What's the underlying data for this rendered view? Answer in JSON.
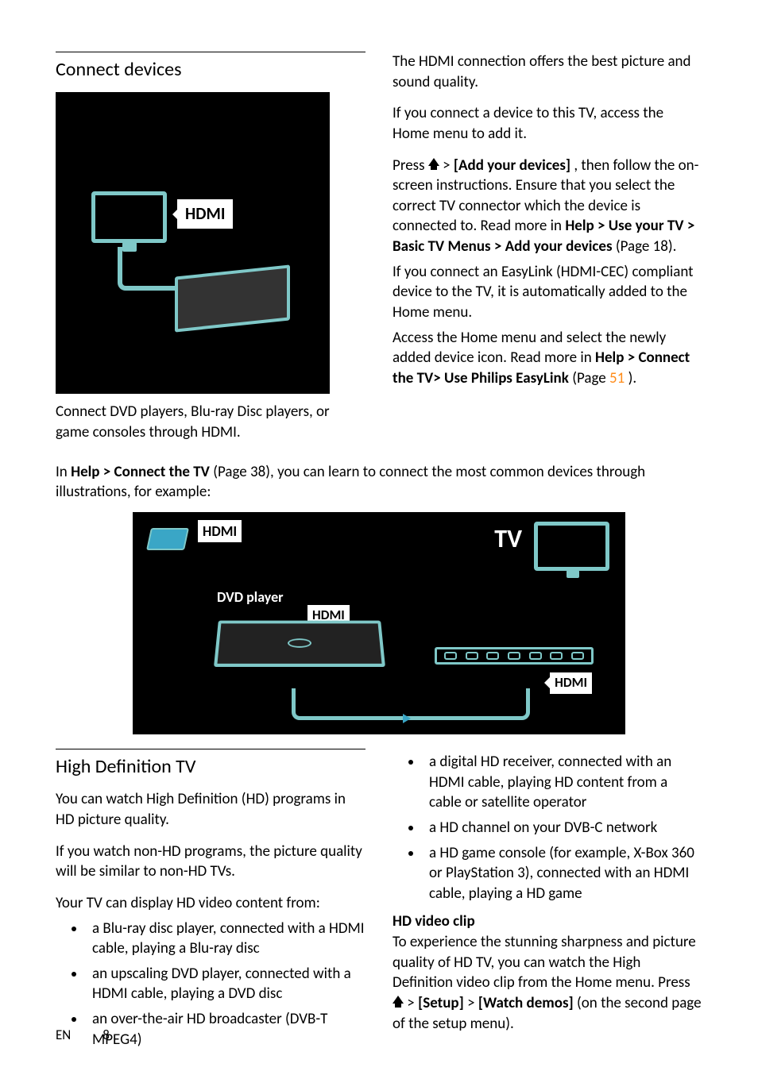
{
  "section1": {
    "heading": "Connect devices",
    "hdmiLabel": "HDMI",
    "caption": "Connect DVD players, Blu-ray Disc players, or game consoles through HDMI."
  },
  "rightCol": {
    "p1": "The HDMI connection offers the best picture and sound quality.",
    "p2": "If you connect a device to this TV, access the Home menu to add it.",
    "p3a": "Press ",
    "p3b": " > ",
    "p3bold1": "[Add your devices]",
    "p3c": ", then follow the on-screen instructions. Ensure that you select the correct TV connector which the device is connected to. Read more in ",
    "p3bold2": "Help > Use your TV > Basic TV Menus > Add your devices",
    "p3d": " (Page 18).",
    "p4": "If you connect an EasyLink (HDMI-CEC) compliant device to the TV, it is automatically added to the Home menu.",
    "p5a": "Access the Home menu and select the newly added device icon. Read more in ",
    "p5bold": "Help > Connect the TV> Use Philips EasyLink",
    "p5b": " (Page ",
    "p5page": "51",
    "p5c": ")."
  },
  "fullWidth": {
    "a": "In ",
    "bold": "Help > Connect the TV",
    "b": " (Page 38), you can learn to connect the most common devices through illustrations, for example:"
  },
  "illus2": {
    "hdmi": "HDMI",
    "tv": "TV",
    "dvd": "DVD player"
  },
  "section2": {
    "heading": "High Definition TV",
    "p1": "You can watch High Definition (HD) programs in HD picture quality.",
    "p2": "If you watch non-HD programs, the picture quality will be similar to non-HD TVs.",
    "p3": "Your TV can display HD video content from:",
    "leftList": [
      "a Blu-ray disc player, connected with a HDMI cable, playing a Blu-ray disc",
      "an upscaling DVD player, connected with a HDMI cable, playing a DVD disc",
      "an over-the-air HD broadcaster (DVB-T MPEG4)"
    ],
    "rightList": [
      "a digital HD receiver, connected with an HDMI cable, playing HD content from a cable or satellite operator",
      "a HD channel on your DVB-C network",
      "a HD game console (for example, X-Box 360 or PlayStation 3), connected with an HDMI cable, playing a HD game"
    ],
    "clipHeading": "HD video clip",
    "clipA": "To experience the stunning sharpness and picture quality of HD TV, you can watch the High Definition video clip from the Home menu. Press ",
    "clipB": " > ",
    "clipBold1": "[Setup]",
    "clipC": " > ",
    "clipBold2": "[Watch demos]",
    "clipD": " (on the second page of the setup menu)."
  },
  "footer": {
    "lang": "EN",
    "page": "8"
  }
}
